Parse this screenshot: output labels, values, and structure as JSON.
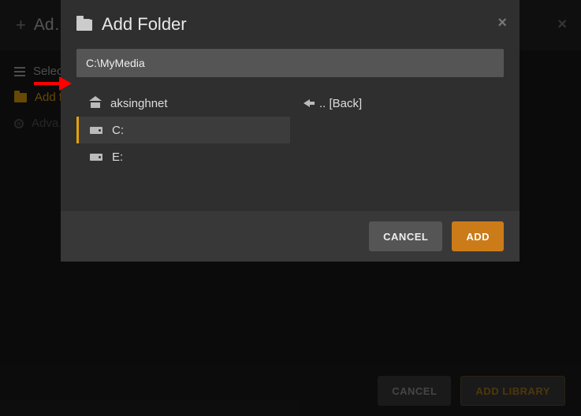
{
  "bg": {
    "title": "Ad…",
    "close": "×",
    "side": {
      "select_label": "Selec…",
      "add_label": "Add f…",
      "advanced_label": "Adva…"
    },
    "footer": {
      "cancel": "CANCEL",
      "primary": "ADD LIBRARY"
    }
  },
  "modal": {
    "title": "Add Folder",
    "close": "×",
    "path_value": "C:\\MyMedia",
    "cols": {
      "left": [
        {
          "icon": "home",
          "label": "aksinghnet",
          "selected": false
        },
        {
          "icon": "drive",
          "label": "C:",
          "selected": true
        },
        {
          "icon": "drive",
          "label": "E:",
          "selected": false
        }
      ],
      "right": [
        {
          "icon": "back",
          "label": ".. [Back]",
          "selected": false
        }
      ]
    },
    "footer": {
      "cancel": "CANCEL",
      "add": "ADD"
    }
  }
}
